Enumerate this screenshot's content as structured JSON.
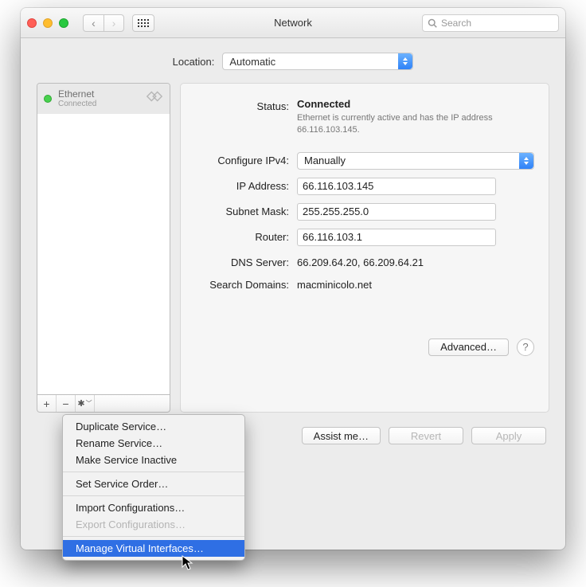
{
  "window": {
    "title": "Network"
  },
  "toolbar": {
    "search_placeholder": "Search"
  },
  "location": {
    "label": "Location:",
    "value": "Automatic"
  },
  "sidebar": {
    "services": [
      {
        "name": "Ethernet",
        "status": "Connected",
        "icon": "ethernet-diamond-icon",
        "dot": "green"
      }
    ]
  },
  "details": {
    "status_label": "Status:",
    "status_value": "Connected",
    "status_sub": "Ethernet is currently active and has the IP address 66.116.103.145.",
    "configure_label": "Configure IPv4:",
    "configure_value": "Manually",
    "ip_label": "IP Address:",
    "ip_value": "66.116.103.145",
    "mask_label": "Subnet Mask:",
    "mask_value": "255.255.255.0",
    "router_label": "Router:",
    "router_value": "66.116.103.1",
    "dns_label": "DNS Server:",
    "dns_value": "66.209.64.20, 66.209.64.21",
    "search_label": "Search Domains:",
    "search_value": "macminicolo.net",
    "advanced": "Advanced…"
  },
  "footer": {
    "assist": "Assist me…",
    "revert": "Revert",
    "apply": "Apply"
  },
  "popup": {
    "items": [
      {
        "label": "Duplicate Service…",
        "disabled": false
      },
      {
        "label": "Rename Service…",
        "disabled": false
      },
      {
        "label": "Make Service Inactive",
        "disabled": false
      },
      {
        "sep": true
      },
      {
        "label": "Set Service Order…",
        "disabled": false
      },
      {
        "sep": true
      },
      {
        "label": "Import Configurations…",
        "disabled": false
      },
      {
        "label": "Export Configurations…",
        "disabled": true
      },
      {
        "sep": true
      },
      {
        "label": "Manage Virtual Interfaces…",
        "disabled": false,
        "selected": true
      }
    ]
  }
}
